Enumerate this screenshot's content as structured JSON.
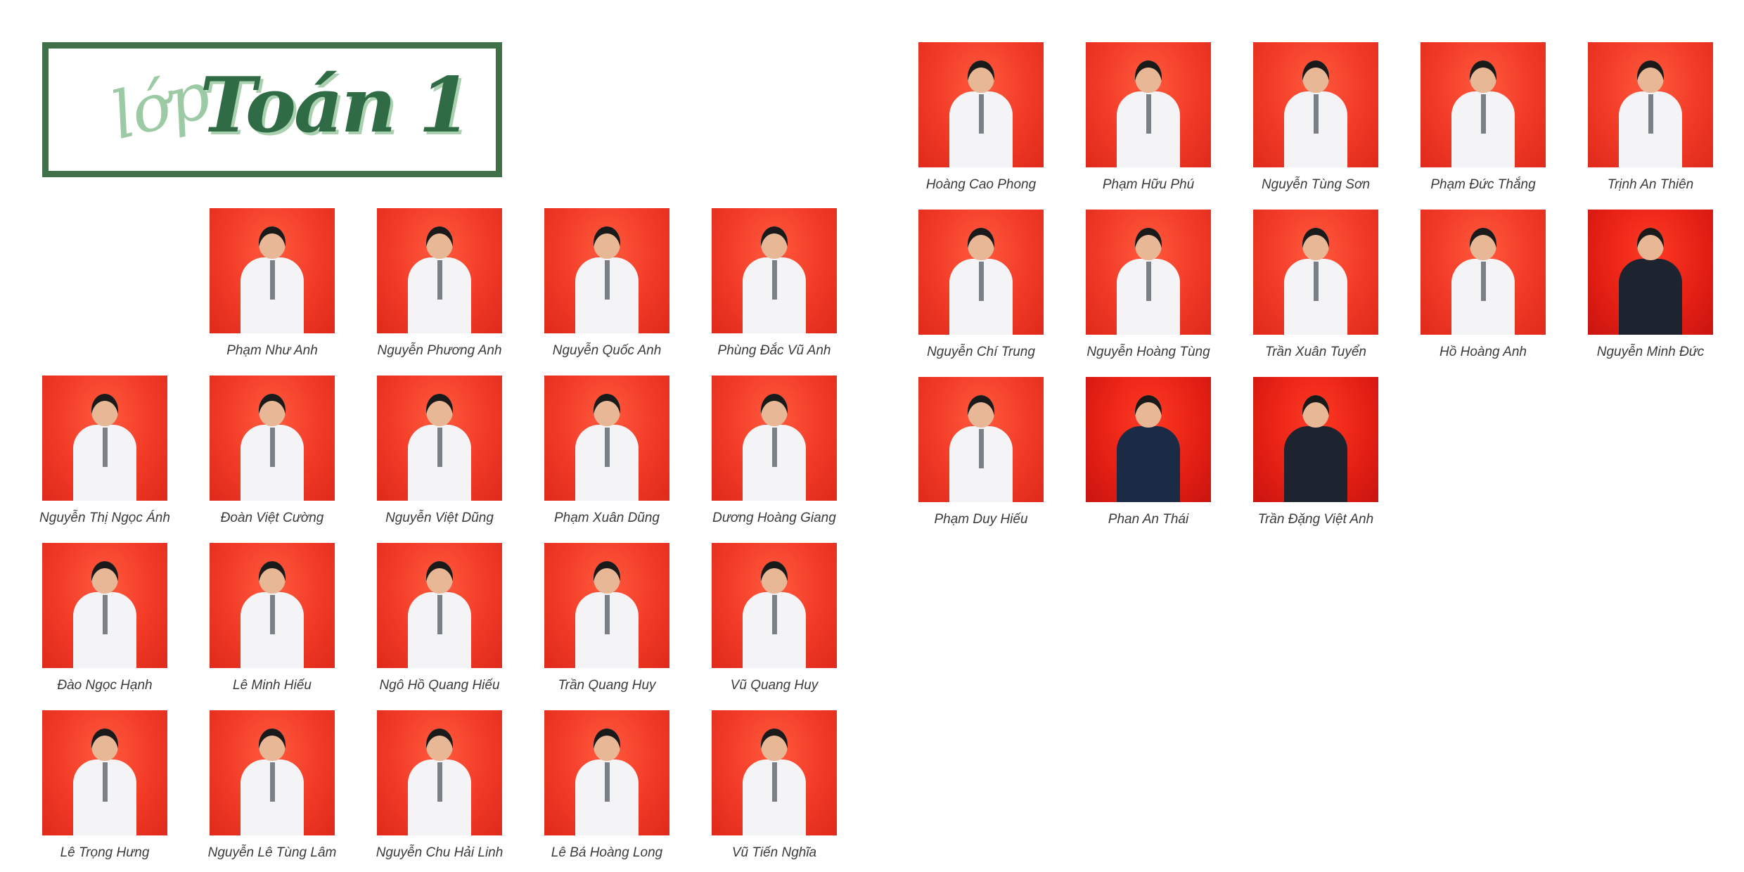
{
  "title": {
    "prefix": "lớp",
    "main": "Toán 1"
  },
  "left_panel": [
    {
      "name": "Phạm Như Anh",
      "col": 1,
      "row": 0
    },
    {
      "name": "Nguyễn Phương Anh",
      "col": 2,
      "row": 0
    },
    {
      "name": "Nguyễn Quốc Anh",
      "col": 3,
      "row": 0
    },
    {
      "name": "Phùng Đắc Vũ Anh",
      "col": 4,
      "row": 0
    },
    {
      "name": "Nguyễn Thị Ngọc Ánh",
      "col": 0,
      "row": 1
    },
    {
      "name": "Đoàn Việt Cường",
      "col": 1,
      "row": 1
    },
    {
      "name": "Nguyễn Việt Dũng",
      "col": 2,
      "row": 1
    },
    {
      "name": "Phạm Xuân Dũng",
      "col": 3,
      "row": 1
    },
    {
      "name": "Dương Hoàng Giang",
      "col": 4,
      "row": 1
    },
    {
      "name": "Đào Ngọc Hạnh",
      "col": 0,
      "row": 2
    },
    {
      "name": "Lê Minh Hiếu",
      "col": 1,
      "row": 2
    },
    {
      "name": "Ngô Hồ Quang Hiếu",
      "col": 2,
      "row": 2
    },
    {
      "name": "Trần Quang Huy",
      "col": 3,
      "row": 2
    },
    {
      "name": "Vũ Quang Huy",
      "col": 4,
      "row": 2
    },
    {
      "name": "Lê Trọng Hưng",
      "col": 0,
      "row": 3
    },
    {
      "name": "Nguyễn Lê Tùng Lâm",
      "col": 1,
      "row": 3
    },
    {
      "name": "Nguyễn Chu Hải Linh",
      "col": 2,
      "row": 3
    },
    {
      "name": "Lê Bá Hoàng Long",
      "col": 3,
      "row": 3
    },
    {
      "name": "Vũ Tiến Nghĩa",
      "col": 4,
      "row": 3
    }
  ],
  "right_panel": [
    {
      "name": "Hoàng Cao Phong",
      "col": 0,
      "row": 0
    },
    {
      "name": "Phạm Hữu Phú",
      "col": 1,
      "row": 0
    },
    {
      "name": "Nguyễn Tùng Sơn",
      "col": 2,
      "row": 0
    },
    {
      "name": "Phạm Đức Thắng",
      "col": 3,
      "row": 0
    },
    {
      "name": "Trịnh An Thiên",
      "col": 4,
      "row": 0
    },
    {
      "name": "Nguyễn Chí Trung",
      "col": 0,
      "row": 1
    },
    {
      "name": "Nguyễn Hoàng Tùng",
      "col": 1,
      "row": 1
    },
    {
      "name": "Trần Xuân Tuyển",
      "col": 2,
      "row": 1
    },
    {
      "name": "Hồ Hoàng Anh",
      "col": 3,
      "row": 1
    },
    {
      "name": "Nguyễn Minh Đức",
      "col": 4,
      "row": 1,
      "outfit": "suit"
    },
    {
      "name": "Phạm Duy Hiếu",
      "col": 0,
      "row": 2
    },
    {
      "name": "Phan An Thái",
      "col": 1,
      "row": 2,
      "outfit": "navy"
    },
    {
      "name": "Trần Đặng Việt Anh",
      "col": 2,
      "row": 2,
      "outfit": "suit"
    }
  ],
  "colors": {
    "frame": "#3f7048",
    "title_main": "#2f6b44",
    "title_prefix": "#9ccaa4",
    "backdrop": "#f23a26"
  }
}
